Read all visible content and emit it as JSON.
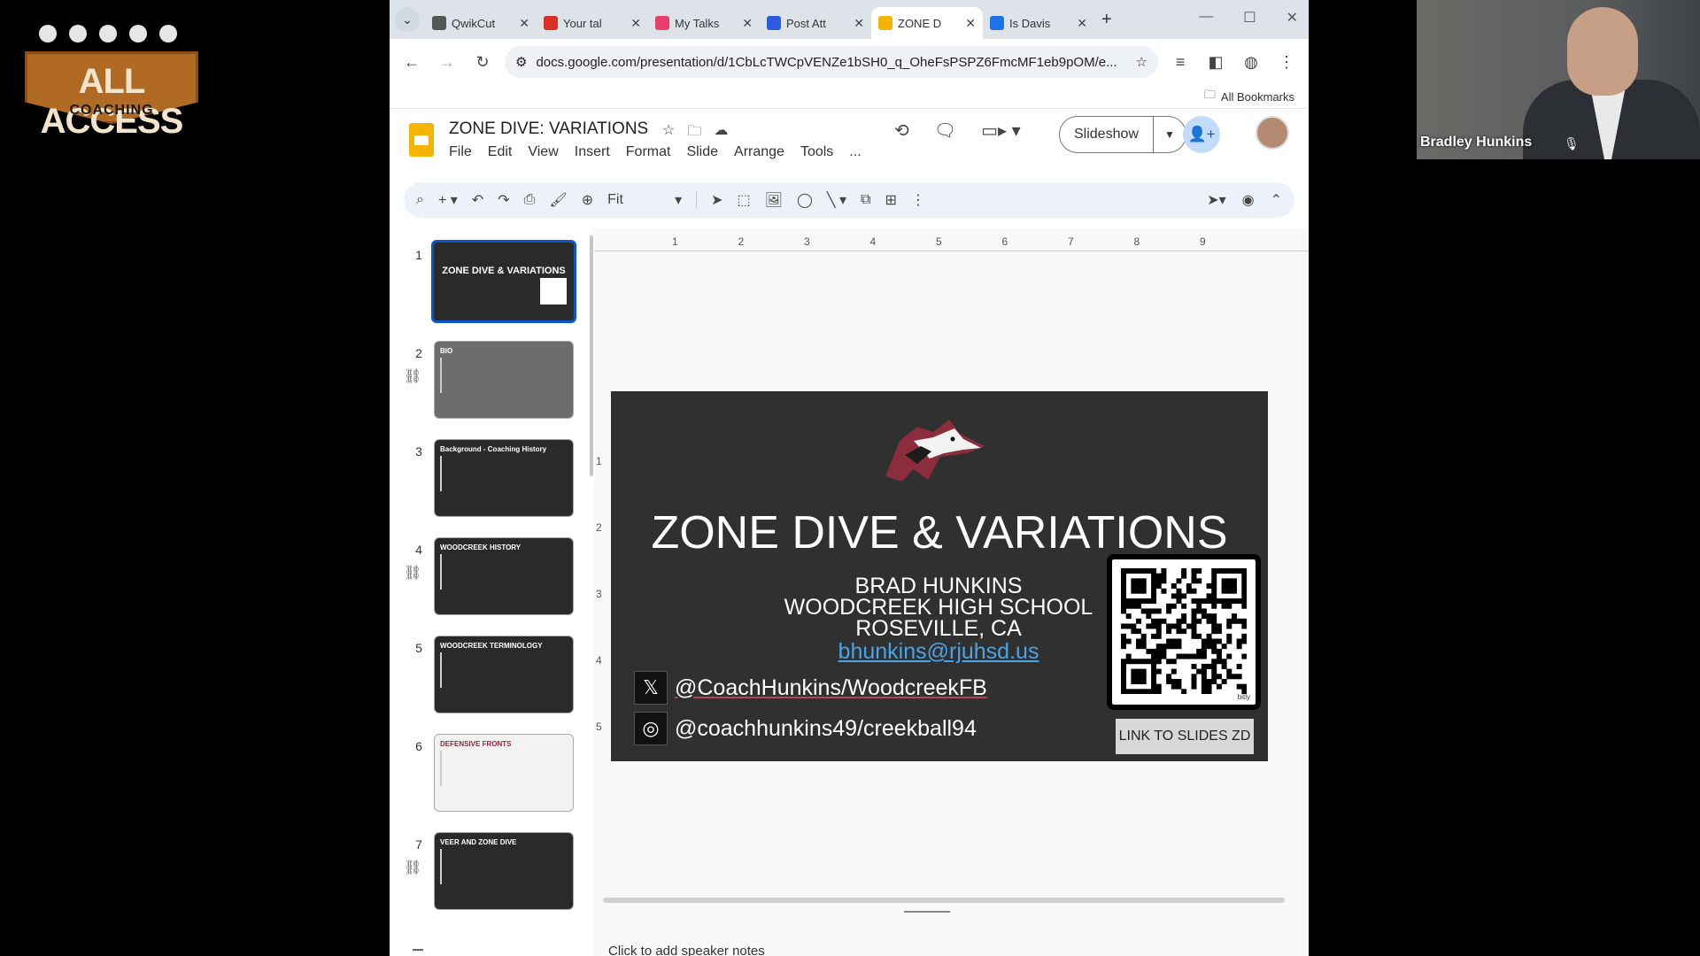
{
  "logo": {
    "line1": "ALL ACCESS",
    "line2": "COACHING"
  },
  "webcam": {
    "name": "Bradley Hunkins"
  },
  "browser": {
    "tabs": [
      {
        "label": "QwikCut",
        "favicon_color": "#555555",
        "active": false
      },
      {
        "label": "Your tal",
        "favicon_color": "#d93025",
        "active": false
      },
      {
        "label": "My Talks",
        "favicon_color": "#e83e6c",
        "active": false
      },
      {
        "label": "Post Att",
        "favicon_color": "#2d5be3",
        "active": false
      },
      {
        "label": "ZONE D",
        "favicon_color": "#f4b400",
        "active": true
      },
      {
        "label": "Is Davis",
        "favicon_color": "#1a73e8",
        "active": false
      }
    ],
    "url": "docs.google.com/presentation/d/1CbLcTWCpVENZe1bSH0_q_OheFsPSPZ6FmcMF1eb9pOM/e...",
    "bookmarks_label": "All Bookmarks"
  },
  "slides": {
    "doc_title": "ZONE DIVE: VARIATIONS",
    "menu": [
      "File",
      "Edit",
      "View",
      "Insert",
      "Format",
      "Slide",
      "Arrange",
      "Tools",
      "..."
    ],
    "slideshow_label": "Slideshow",
    "zoom_label": "Fit",
    "ruler_h": [
      "1",
      "2",
      "3",
      "4",
      "5",
      "6",
      "7",
      "8",
      "9"
    ],
    "ruler_v": [
      "1",
      "2",
      "3",
      "4",
      "5"
    ],
    "thumbnails": [
      {
        "num": "1",
        "title": "ZONE DIVE & VARIATIONS",
        "style": "dark",
        "has_link": false,
        "selected": true
      },
      {
        "num": "2",
        "title": "BIO",
        "style": "lite",
        "has_link": true,
        "selected": false
      },
      {
        "num": "3",
        "title": "Background - Coaching History",
        "style": "dark",
        "has_link": false,
        "selected": false
      },
      {
        "num": "4",
        "title": "WOODCREEK HISTORY",
        "style": "dark",
        "has_link": true,
        "selected": false
      },
      {
        "num": "5",
        "title": "WOODCREEK TERMINOLOGY",
        "style": "dark",
        "has_link": false,
        "selected": false
      },
      {
        "num": "6",
        "title": "DEFENSIVE FRONTS",
        "style": "white",
        "has_link": false,
        "selected": false
      },
      {
        "num": "7",
        "title": "VEER AND ZONE DIVE",
        "style": "dark",
        "has_link": true,
        "selected": false
      }
    ],
    "slide": {
      "title": "ZONE DIVE & VARIATIONS",
      "presenter": [
        "BRAD HUNKINS",
        "WOODCREEK HIGH SCHOOL",
        "ROSEVILLE, CA"
      ],
      "email": "bhunkins@rjuhsd.us",
      "twitter": "@CoachHunkins/WoodcreekFB",
      "instagram": "@coachhunkins49/creekball94",
      "qr_label": "LINK TO SLIDES ZD",
      "qr_caption": "bitly"
    },
    "speaker_notes_placeholder": "Click to add speaker notes"
  }
}
